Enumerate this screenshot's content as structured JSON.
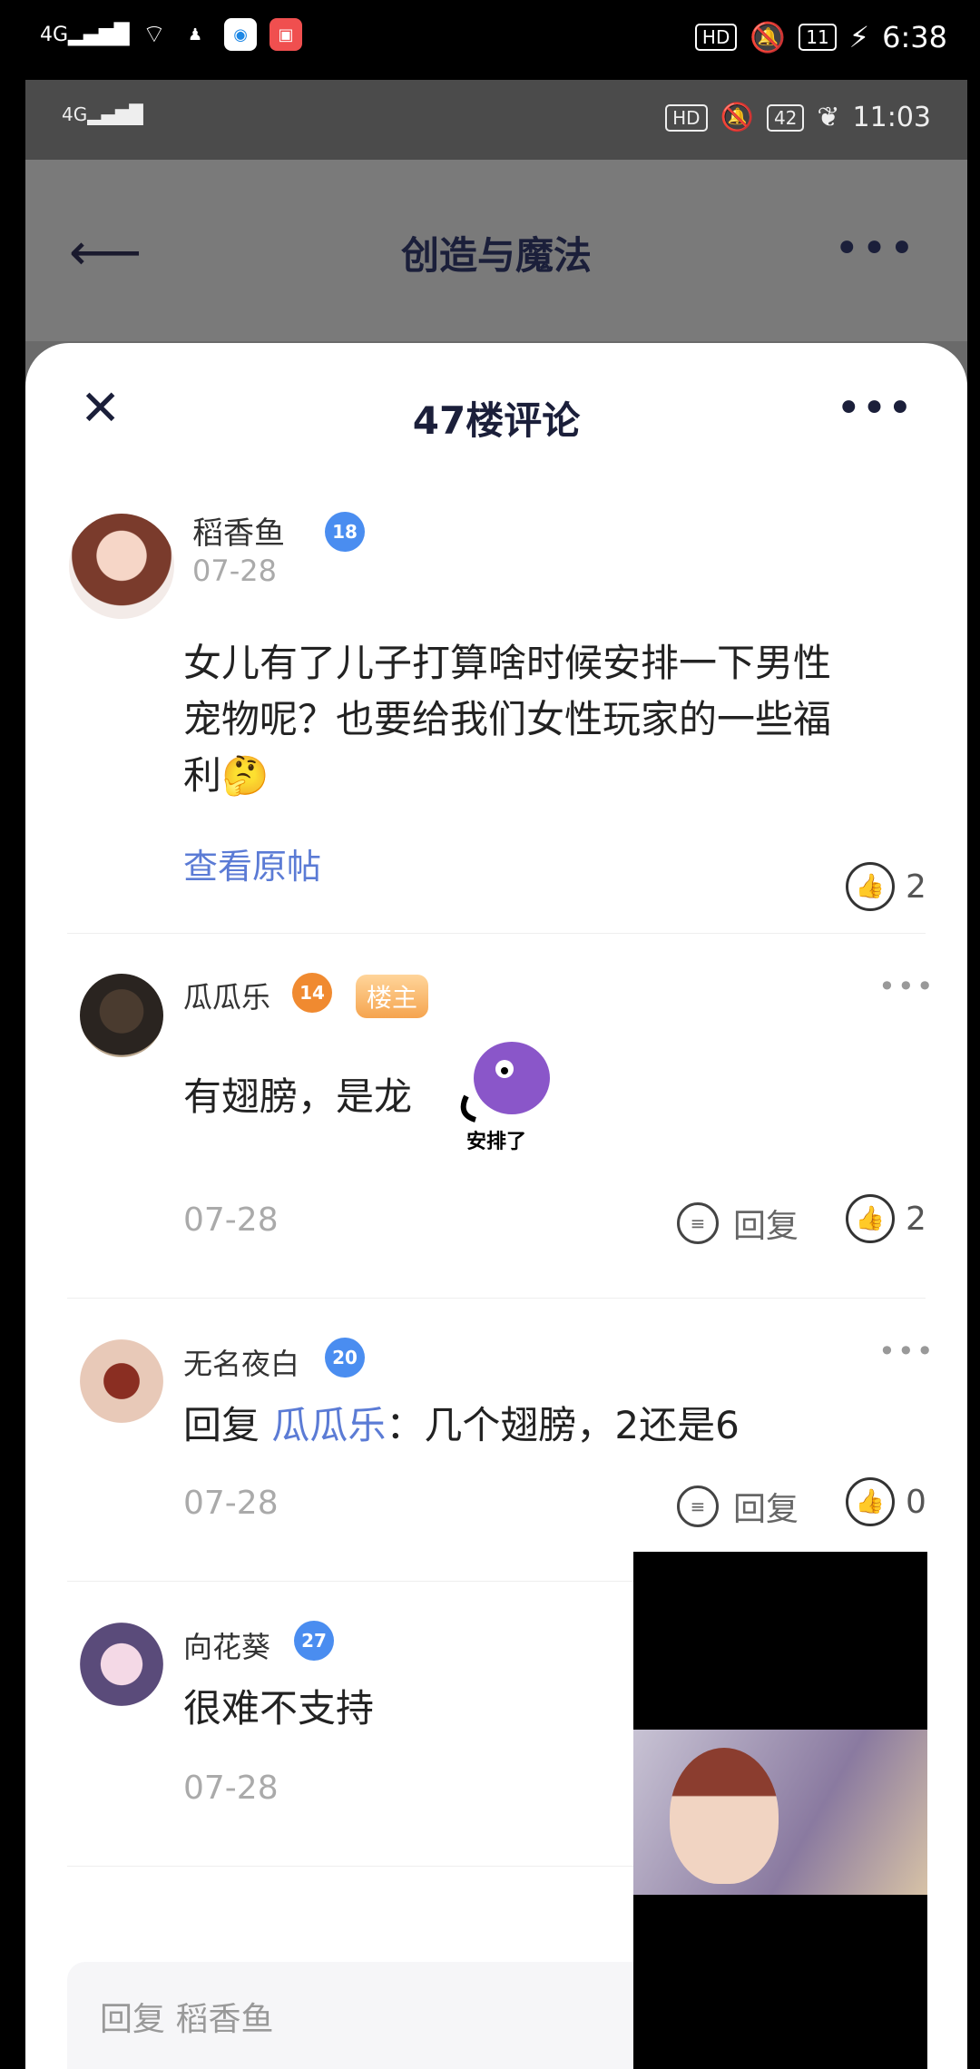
{
  "outer_status": {
    "left_signal": "4G",
    "battery": "11",
    "time": "6:38",
    "hd": "HD"
  },
  "inner_status": {
    "left_signal": "4G",
    "battery": "42",
    "time": "11:03",
    "hd": "HD"
  },
  "app_header": {
    "title": "创造与魔法"
  },
  "sheet": {
    "title": "47楼评论"
  },
  "original_post": {
    "author": "稻香鱼",
    "level": "18",
    "date": "07-28",
    "text_line1": "女儿有了儿子打算啥时候安排一下男性",
    "text_line2": "宠物呢？也要给我们女性玩家的一些福",
    "text_line3": "利",
    "view_original": "查看原帖",
    "likes": "2"
  },
  "comments": [
    {
      "author": "瓜瓜乐",
      "level": "14",
      "tag": "楼主",
      "text": "有翅膀，是龙",
      "sticker_text": "安排了",
      "date": "07-28",
      "reply_label": "回复",
      "likes": "2"
    },
    {
      "author": "无名夜白",
      "level": "20",
      "reply_prefix": "回复",
      "reply_to": "瓜瓜乐",
      "text": "：几个翅膀，2还是6",
      "date": "07-28",
      "reply_label": "回复",
      "likes": "0"
    },
    {
      "author": "向花葵",
      "level": "27",
      "text": "很难不支持",
      "date": "07-28"
    }
  ],
  "reply_input": {
    "placeholder": "回复 稻香鱼"
  },
  "colors": {
    "accent": "#5b7bd5",
    "level_blue": "#4a8df0",
    "level_orange": "#f08a30"
  }
}
